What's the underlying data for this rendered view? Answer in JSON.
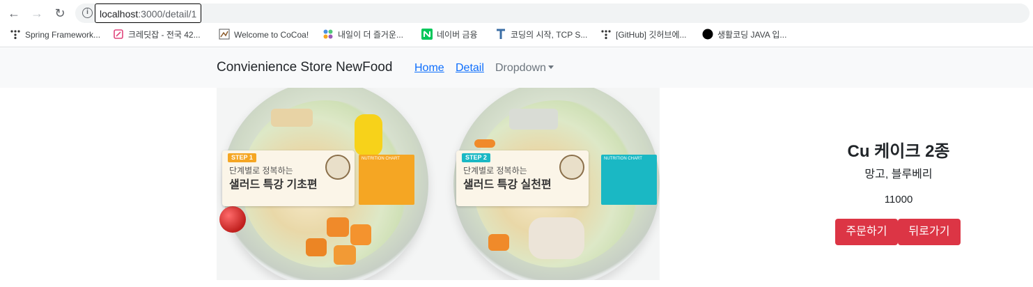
{
  "browser": {
    "url_host": "localhost",
    "url_path": ":3000/detail/1",
    "bookmarks": [
      {
        "label": "Spring Framework...",
        "icon": "dots-icon"
      },
      {
        "label": "크레딧잡 - 전국 42...",
        "icon": "creditjob-icon"
      },
      {
        "label": "Welcome to CoCoa!",
        "icon": "cocoa-icon"
      },
      {
        "label": "내일이 더 즐거운...",
        "icon": "dots-color-icon"
      },
      {
        "label": "네이버 금융",
        "icon": "naver-icon"
      },
      {
        "label": "코딩의 시작, TCP S...",
        "icon": "tcp-school-icon"
      },
      {
        "label": "[GitHub] 깃허브에...",
        "icon": "dots-icon"
      },
      {
        "label": "생활코딩 JAVA 입...",
        "icon": "black-circle-icon"
      }
    ]
  },
  "navbar": {
    "brand": "Convienience Store NewFood",
    "links": {
      "home": "Home",
      "detail": "Detail",
      "dropdown": "Dropdown"
    }
  },
  "image": {
    "left_card": {
      "step": "STEP 1",
      "line1": "단계별로 정복하는",
      "line2": "샐러드 특강 기초편"
    },
    "right_card": {
      "step": "STEP 2",
      "line1": "단계별로 정복하는",
      "line2": "샐러드 특강 실천편"
    },
    "chart_label": "NUTRITION CHART"
  },
  "product": {
    "name": "Cu 케이크 2종",
    "description": "망고, 블루베리",
    "price": "11000"
  },
  "buttons": {
    "order": "주문하기",
    "back": "뒤로가기"
  },
  "colors": {
    "danger": "#dc3545",
    "link": "#0d6efd",
    "step1": "#f5a623",
    "step2": "#1ab8c4"
  }
}
